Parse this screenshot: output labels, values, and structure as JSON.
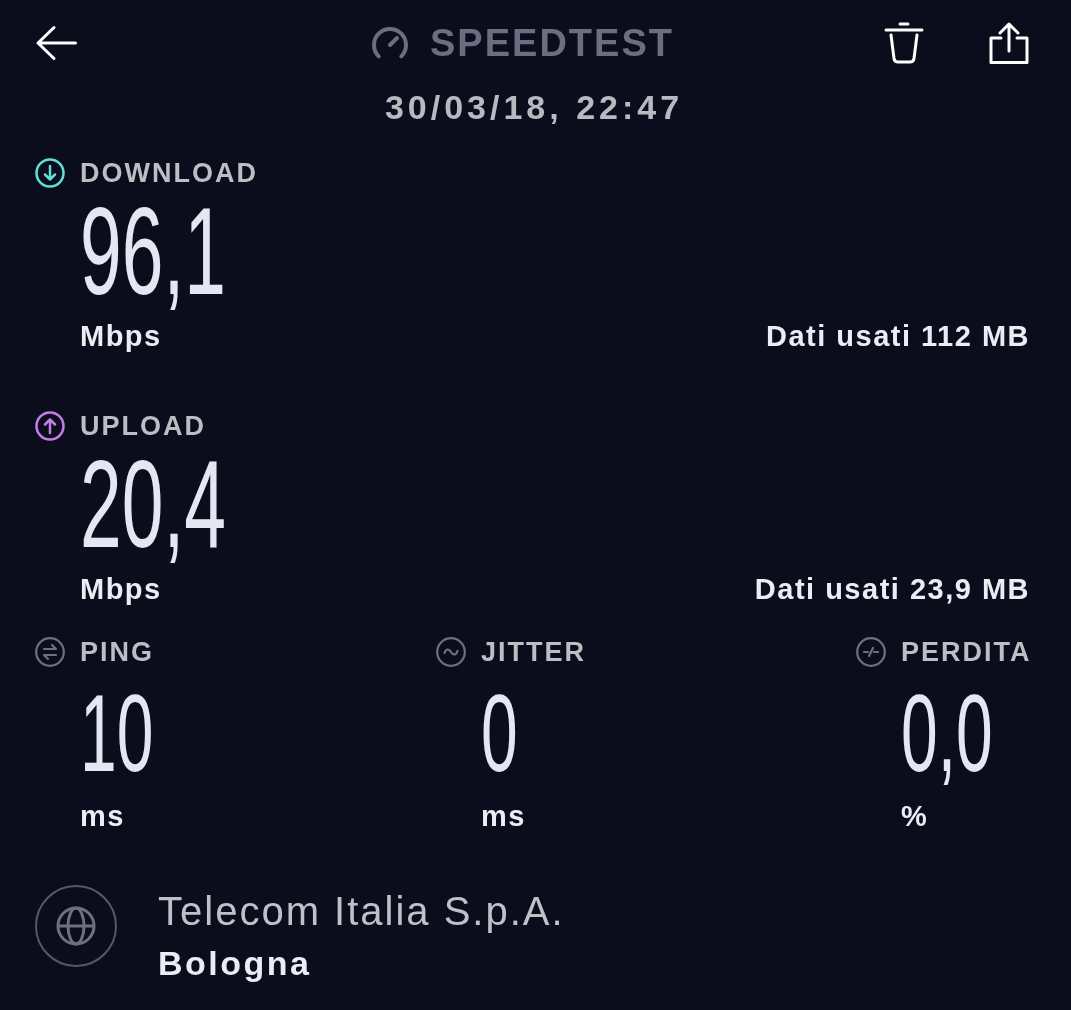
{
  "header": {
    "title": "SPEEDTEST",
    "timestamp": "30/03/18, 22:47"
  },
  "transfers": [
    {
      "kind": "download",
      "label": "DOWNLOAD",
      "color": "#5fe0d6",
      "value": "96,1",
      "unit": "Mbps",
      "data_used": "Dati usati 112 MB"
    },
    {
      "kind": "upload",
      "label": "UPLOAD",
      "color": "#c67ce8",
      "value": "20,4",
      "unit": "Mbps",
      "data_used": "Dati usati 23,9 MB"
    }
  ],
  "metrics": [
    {
      "kind": "ping",
      "label": "PING",
      "value": "10",
      "unit": "ms"
    },
    {
      "kind": "jitter",
      "label": "JITTER",
      "value": "0",
      "unit": "ms"
    },
    {
      "kind": "loss",
      "label": "PERDITA",
      "value": "0,0",
      "unit": "%"
    }
  ],
  "provider": {
    "name": "Telecom Italia S.p.A.",
    "location": "Bologna"
  }
}
